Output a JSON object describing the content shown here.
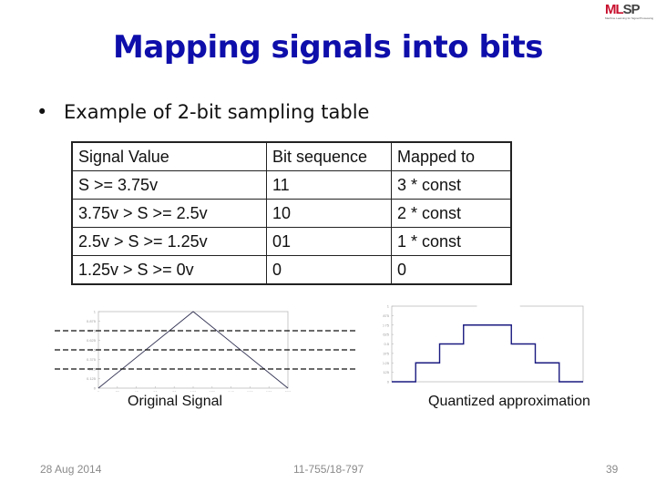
{
  "slide": {
    "title": "Mapping signals into bits",
    "bullet": "Example of 2-bit sampling table",
    "bullet_glyph": "•",
    "logo": {
      "main": "ML",
      "accent": "SP",
      "sub": "Machine Learning for Signal Processing"
    },
    "colors": {
      "title": "#0e0eab",
      "logo_red": "#c8102e",
      "signal_line": "#1a1a80"
    }
  },
  "table": {
    "headers": [
      "Signal Value",
      "Bit sequence",
      "Mapped to"
    ],
    "rows": [
      [
        "S >= 3.75v",
        "11",
        "3 * const"
      ],
      [
        "3.75v > S >= 2.5v",
        "10",
        "2 * const"
      ],
      [
        "2.5v > S >= 1.25v",
        "01",
        "1 * const"
      ],
      [
        "1.25v > S >= 0v",
        "0",
        "0"
      ]
    ]
  },
  "figures": {
    "original_caption": "Original Signal",
    "quantized_caption": "Quantized approximation"
  },
  "footer": {
    "date": "28 Aug 2014",
    "course": "11-755/18-797",
    "page": "39"
  },
  "chart_data": [
    {
      "type": "line",
      "title": "Original Signal",
      "x": [
        0,
        100,
        200
      ],
      "y": [
        0,
        1,
        0
      ],
      "xlim": [
        0,
        200
      ],
      "ylim": [
        0,
        1
      ],
      "xticks": [
        0,
        20,
        40,
        60,
        80,
        100,
        120,
        140,
        160,
        180,
        200
      ],
      "yticks": [
        0,
        0.125,
        0.25,
        0.375,
        0.5,
        0.625,
        0.75,
        0.875,
        1
      ],
      "threshold_lines": [
        0.25,
        0.5,
        0.75
      ],
      "threshold_style": "dashed",
      "grid": false,
      "legend": "none"
    },
    {
      "type": "line",
      "title": "Quantized approximation",
      "step": true,
      "x": [
        0,
        25,
        25,
        50,
        50,
        75,
        75,
        125,
        125,
        150,
        150,
        175,
        175,
        200
      ],
      "y": [
        0,
        0,
        0.25,
        0.25,
        0.5,
        0.5,
        0.75,
        0.75,
        0.5,
        0.5,
        0.25,
        0.25,
        0,
        0
      ],
      "xlim": [
        0,
        200
      ],
      "ylim": [
        0,
        1
      ],
      "yticks": [
        0,
        0.125,
        0.25,
        0.375,
        0.5,
        0.625,
        0.75,
        0.875,
        1
      ],
      "grid": false,
      "legend": "none"
    }
  ]
}
